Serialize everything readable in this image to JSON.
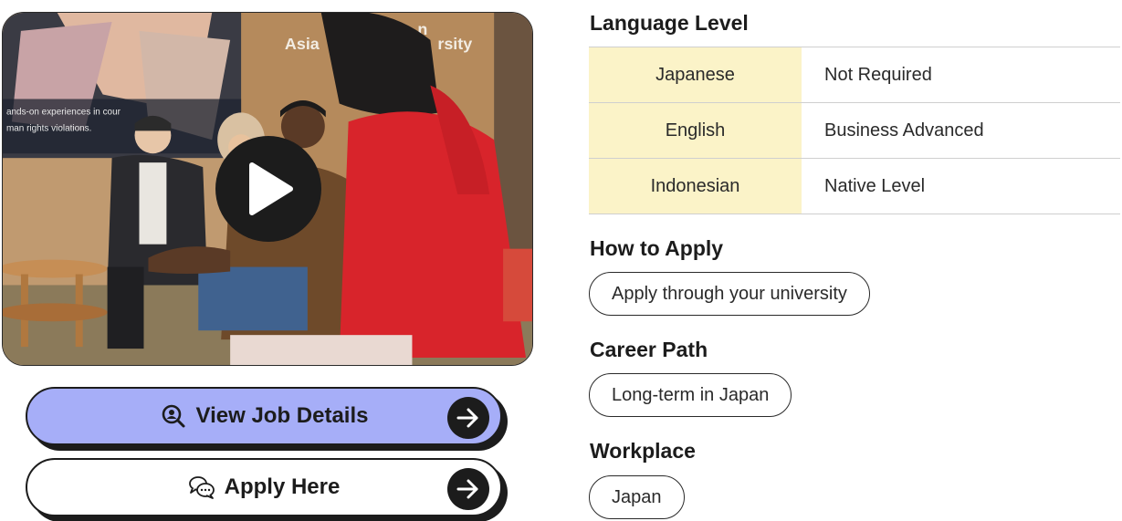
{
  "buttons": {
    "view_details": "View Job Details",
    "apply": "Apply Here"
  },
  "video": {
    "wall_text_1": "Asia",
    "wall_text_2": "n",
    "wall_text_3": "rsity",
    "screen_text_1": "ands-on experiences in cour",
    "screen_text_2": "man rights violations."
  },
  "language": {
    "heading": "Language Level",
    "rows": [
      {
        "language": "Japanese",
        "level": "Not Required"
      },
      {
        "language": "English",
        "level": "Business Advanced"
      },
      {
        "language": "Indonesian",
        "level": "Native Level"
      }
    ]
  },
  "how_to_apply": {
    "heading": "How to Apply",
    "value": "Apply through your university"
  },
  "career_path": {
    "heading": "Career Path",
    "value": "Long-term in Japan"
  },
  "workplace": {
    "heading": "Workplace",
    "value": "Japan"
  },
  "colors": {
    "primary_button": "#a6aef8",
    "table_highlight": "#fbf3c8",
    "dark": "#1c1c1c"
  },
  "icons": [
    "play-icon",
    "search-person-icon",
    "chat-bubbles-icon",
    "arrow-right-icon"
  ]
}
